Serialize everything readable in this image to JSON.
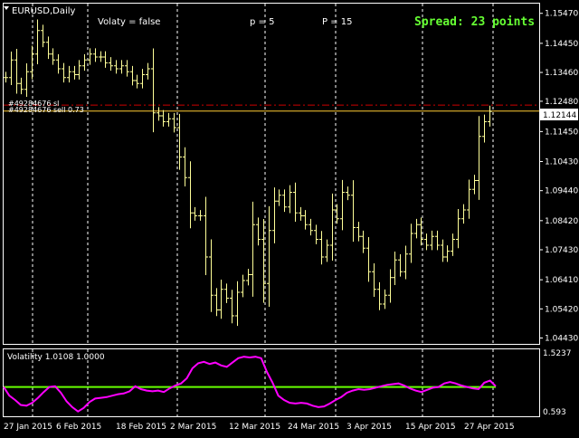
{
  "chart_data": [
    {
      "type": "bar",
      "subtype": "ohlc",
      "title": "EURUSD,Daily",
      "symbol": "EURUSD",
      "timeframe": "Daily",
      "ylim": [
        1.0423,
        1.158
      ],
      "y_ticks": [
        "1.15470",
        "1.14450",
        "1.13460",
        "1.12480",
        "1.11450",
        "1.10430",
        "1.09440",
        "1.08420",
        "1.07430",
        "1.06410",
        "1.05420",
        "1.04430"
      ],
      "current_price": "1.12144",
      "annotations": {
        "volaty": "Volaty =  false",
        "p": "p =  5",
        "P": "P =  15",
        "spread": "Spread: 23 points",
        "order_1": "#49284676 sl",
        "order_2": "#49284676 sell 0.73"
      },
      "lines": {
        "order_level": 1.1235,
        "current": 1.12144
      },
      "values": [
        1.133,
        1.139,
        1.131,
        1.129,
        1.135,
        1.141,
        1.149,
        1.145,
        1.141,
        1.139,
        1.136,
        1.133,
        1.135,
        1.134,
        1.137,
        1.139,
        1.141,
        1.14,
        1.14,
        1.138,
        1.137,
        1.136,
        1.137,
        1.135,
        1.132,
        1.131,
        1.134,
        1.136,
        1.121,
        1.12,
        1.118,
        1.119,
        1.116,
        1.106,
        1.099,
        1.087,
        1.086,
        1.086,
        1.072,
        1.059,
        1.054,
        1.061,
        1.058,
        1.052,
        1.06,
        1.064,
        1.066,
        1.083,
        1.078,
        1.063,
        1.081,
        1.091,
        1.093,
        1.089,
        1.094,
        1.087,
        1.086,
        1.083,
        1.081,
        1.078,
        1.072,
        1.076,
        1.088,
        1.085,
        1.094,
        1.093,
        1.082,
        1.079,
        1.075,
        1.067,
        1.061,
        1.056,
        1.059,
        1.065,
        1.071,
        1.067,
        1.073,
        1.08,
        1.083,
        1.078,
        1.076,
        1.079,
        1.076,
        1.072,
        1.074,
        1.078,
        1.085,
        1.088,
        1.095,
        1.098,
        1.113,
        1.118,
        1.1215
      ],
      "x_labels": [
        "27 Jan 2015",
        "6 Feb 2015",
        "18 Feb 2015",
        "2 Mar 2015",
        "12 Mar 2015",
        "24 Mar 2015",
        "3 Apr 2015",
        "15 Apr 2015",
        "27 Apr 2015"
      ],
      "colors": {
        "bars": "#FFFF99",
        "grid": "#FFFFFF",
        "order": "#CC0000",
        "current": "#FFCC33",
        "spread": "#66FF33"
      }
    },
    {
      "type": "line",
      "title": "Volatility 1.0108 1.0000",
      "ylim": [
        0.593,
        1.5237
      ],
      "y_ticks": [
        "1.5237",
        "0.593"
      ],
      "series": [
        {
          "values": [
            1.0,
            0.88,
            0.82,
            0.75,
            0.74,
            0.78,
            0.85,
            0.93,
            1.0,
            1.01,
            0.92,
            0.8,
            0.72,
            0.66,
            0.71,
            0.79,
            0.84,
            0.85,
            0.86,
            0.88,
            0.9,
            0.91,
            0.94,
            1.01,
            0.97,
            0.95,
            0.94,
            0.95,
            0.93,
            0.98,
            1.02,
            1.05,
            1.12,
            1.26,
            1.33,
            1.35,
            1.32,
            1.34,
            1.3,
            1.28,
            1.34,
            1.4,
            1.42,
            1.41,
            1.42,
            1.4,
            1.21,
            1.06,
            0.88,
            0.82,
            0.78,
            0.77,
            0.78,
            0.77,
            0.74,
            0.72,
            0.73,
            0.77,
            0.82,
            0.86,
            0.92,
            0.95,
            0.97,
            0.96,
            0.97,
            0.99,
            1.01,
            1.03,
            1.04,
            1.05,
            1.02,
            0.98,
            0.95,
            0.93,
            0.96,
            0.99,
            1.0,
            1.05,
            1.07,
            1.05,
            1.02,
            1.0,
            0.98,
            0.97,
            1.06,
            1.09,
            1.0108
          ]
        },
        {
          "values": [
            1.0
          ]
        }
      ],
      "colors": {
        "line": "#FF00FF",
        "level": "#66FF00"
      }
    }
  ]
}
